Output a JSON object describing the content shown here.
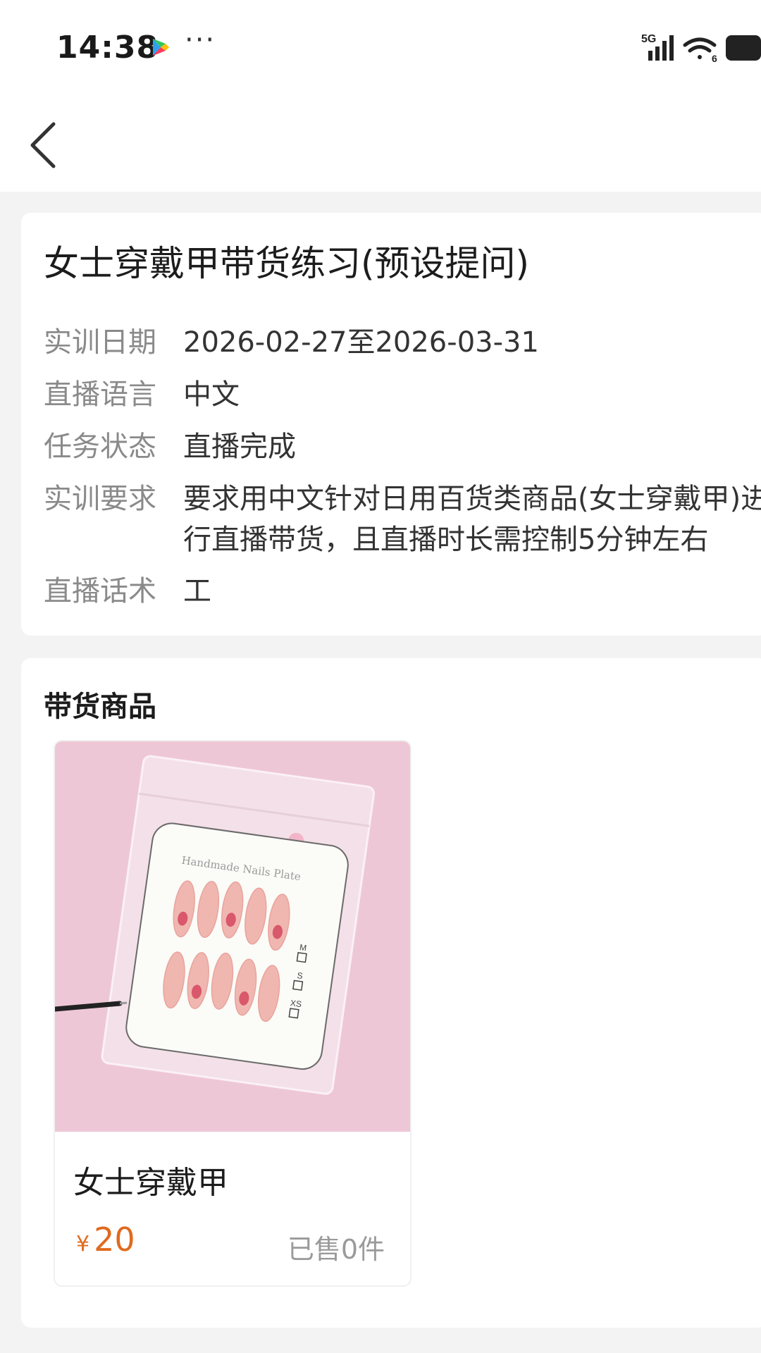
{
  "status_bar": {
    "time": "14:38",
    "dots": "···",
    "network": "5G",
    "wifi_badge": "6",
    "icons": [
      "play-store-icon",
      "more-dots-icon",
      "signal-icon",
      "wifi-icon",
      "battery-icon"
    ]
  },
  "nav": {
    "back_icon": "chevron-left-icon"
  },
  "task": {
    "title": "女士穿戴甲带货练习(预设提问)",
    "rows": [
      {
        "label": "实训日期",
        "value": "2026-02-27至2026-03-31"
      },
      {
        "label": "直播语言",
        "value": "中文"
      },
      {
        "label": "任务状态",
        "value": "直播完成"
      },
      {
        "label": "实训要求",
        "value": "要求用中文针对日用百货类商品(女士穿戴甲)进行直播带货，且直播时长需控制5分钟左右"
      },
      {
        "label": "直播话术",
        "value": "工"
      }
    ]
  },
  "goods": {
    "heading": "带货商品",
    "products": [
      {
        "name": "女士穿戴甲",
        "price_symbol": "¥",
        "price": "20",
        "sold": "已售0件",
        "image_text": "Handmade Nails Plate",
        "sizes": [
          "M",
          "S",
          "XS"
        ]
      }
    ]
  },
  "colors": {
    "accent_price": "#e06a1e",
    "background": "#f3f3f3",
    "card": "#ffffff",
    "label_gray": "#8a8a8a"
  }
}
